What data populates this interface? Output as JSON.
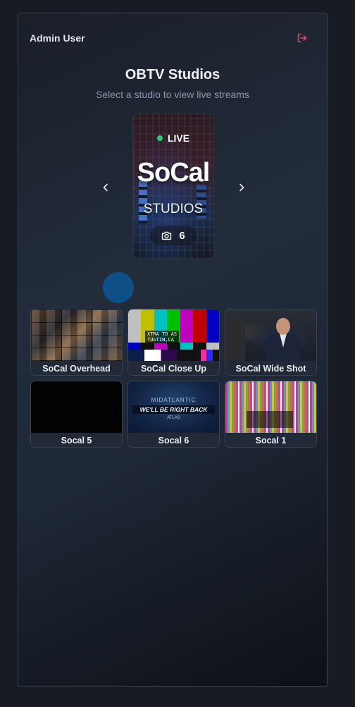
{
  "header": {
    "user_name": "Admin User",
    "logout_icon": "logout-icon",
    "logout_color": "#d9455f"
  },
  "page": {
    "title": "OBTV Studios",
    "subtitle": "Select a studio to view live streams"
  },
  "carousel": {
    "prev_icon": "chevron-left-icon",
    "next_icon": "chevron-right-icon",
    "active_studio": {
      "live_label": "LIVE",
      "live_color": "#2ecc71",
      "name": "SoCal",
      "subname": "STUDIOS",
      "camera_count": "6",
      "camera_icon": "camera-icon"
    },
    "indicator_color": "#0d4f86"
  },
  "streams": [
    {
      "label": "SoCal Overhead",
      "thumb": "multiview-grid"
    },
    {
      "label": "SoCal Close Up",
      "thumb": "color-bars"
    },
    {
      "label": "SoCal Wide Shot",
      "thumb": "anchor-desk"
    },
    {
      "label": "Socal 5",
      "thumb": "black"
    },
    {
      "label": "Socal 6",
      "thumb": "we-will-be-right-back"
    },
    {
      "label": "Socal 1",
      "thumb": "color-strips"
    }
  ],
  "thumb_text": {
    "bars_caption": "XTRA TO AS\nTUSTIN,CA",
    "brb_small": "MIDATLANTIC",
    "brb_main": "WE'LL BE RIGHT BACK",
    "brb_logo": "ATLAS"
  }
}
